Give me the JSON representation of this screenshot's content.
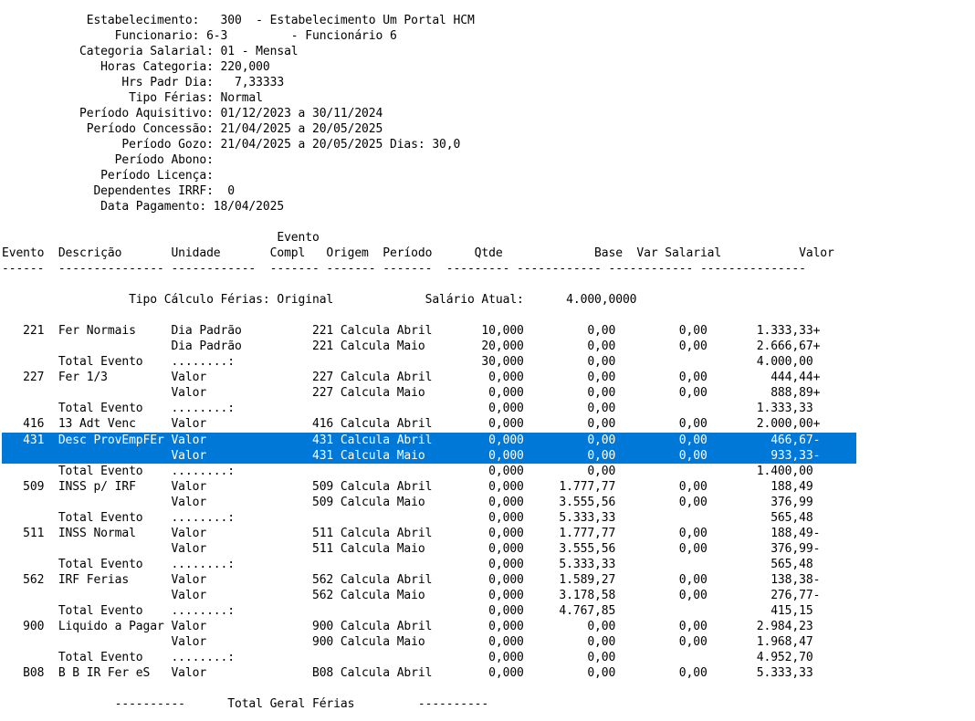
{
  "header": [
    "            Estabelecimento:   300  - Estabelecimento Um Portal HCM",
    "                Funcionario: 6-3         - Funcionário 6",
    "           Categoria Salarial: 01 - Mensal",
    "              Horas Categoria: 220,000",
    "                 Hrs Padr Dia:   7,33333",
    "                  Tipo Férias: Normal",
    "           Período Aquisitivo: 01/12/2023 a 30/11/2024",
    "            Período Concessão: 21/04/2025 a 20/05/2025",
    "                 Período Gozo: 21/04/2025 a 20/05/2025 Dias: 30,0",
    "                Período Abono:",
    "              Período Licença:",
    "             Dependentes IRRF:  0",
    "              Data Pagamento: 18/04/2025"
  ],
  "columns": {
    "line1": "                                       Evento",
    "line2": "Evento  Descrição       Unidade       Compl   Origem  Período      Qtde             Base  Var Salarial           Valor",
    "separator": "------  --------------- ------------  ------- ------- -------  --------- ------------ ------------ ---------------"
  },
  "calc_info": "                  Tipo Cálculo Férias: Original             Salário Atual:      4.000,0000",
  "rows": [
    "   221  Fer Normais     Dia Padrão          221 Calcula Abril       10,000         0,00         0,00       1.333,33+",
    "                        Dia Padrão          221 Calcula Maio        20,000         0,00         0,00       2.666,67+",
    "        Total Evento    ........:                                   30,000         0,00                    4.000,00",
    "   227  Fer 1/3         Valor               227 Calcula Abril        0,000         0,00         0,00         444,44+",
    "                        Valor               227 Calcula Maio         0,000         0,00         0,00         888,89+",
    "        Total Evento    ........:                                    0,000         0,00                    1.333,33",
    "   416  13 Adt Venc     Valor               416 Calcula Abril        0,000         0,00         0,00       2.000,00+",
    "   431  Desc ProvEmpFEr Valor               431 Calcula Abril        0,000         0,00         0,00         466,67-",
    "                        Valor               431 Calcula Maio         0,000         0,00         0,00         933,33-",
    "        Total Evento    ........:                                    0,000         0,00                    1.400,00",
    "   509  INSS p/ IRF     Valor               509 Calcula Abril        0,000     1.777,77         0,00         188,49",
    "                        Valor               509 Calcula Maio         0,000     3.555,56         0,00         376,99",
    "        Total Evento    ........:                                    0,000     5.333,33                      565,48",
    "   511  INSS Normal     Valor               511 Calcula Abril        0,000     1.777,77         0,00         188,49-",
    "                        Valor               511 Calcula Maio         0,000     3.555,56         0,00         376,99-",
    "        Total Evento    ........:                                    0,000     5.333,33                      565,48",
    "   562  IRF Ferias      Valor               562 Calcula Abril        0,000     1.589,27         0,00         138,38-",
    "                        Valor               562 Calcula Maio         0,000     3.178,58         0,00         276,77-",
    "        Total Evento    ........:                                    0,000     4.767,85                      415,15",
    "   900  Liquido a Pagar Valor               900 Calcula Abril        0,000         0,00         0,00       2.984,23",
    "                        Valor               900 Calcula Maio         0,000         0,00         0,00       1.968,47",
    "        Total Evento    ........:                                    0,000         0,00                    4.952,70",
    "   B08  B B IR Fer eS   Valor               B08 Calcula Abril        0,000         0,00         0,00       5.333,33"
  ],
  "footer": "                ----------      Total Geral Férias         ----------",
  "selection_color": "#0078d7"
}
